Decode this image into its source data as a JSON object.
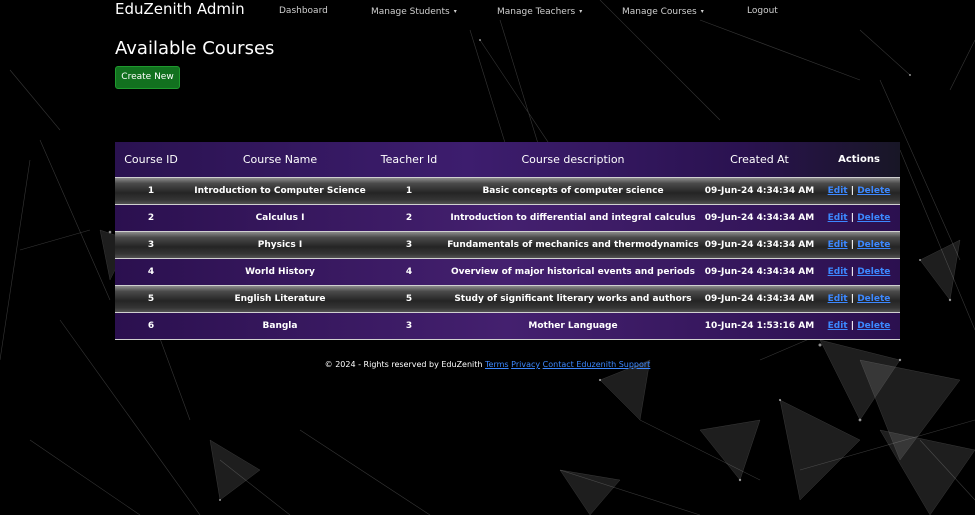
{
  "nav": {
    "brand": "EduZenith Admin",
    "items": [
      "Dashboard",
      "Manage Students",
      "Manage Teachers",
      "Manage Courses",
      "Logout"
    ],
    "caret": "▾"
  },
  "page": {
    "title": "Available Courses",
    "create_label": "Create New"
  },
  "table": {
    "headers": [
      "Course ID",
      "Course Name",
      "Teacher Id",
      "Course description",
      "Created At",
      "Actions"
    ],
    "rows": [
      {
        "id": "1",
        "name": "Introduction to Computer Science",
        "teacher": "1",
        "desc": "Basic concepts of computer science",
        "created": "09-Jun-24 4:34:34 AM"
      },
      {
        "id": "2",
        "name": "Calculus I",
        "teacher": "2",
        "desc": "Introduction to differential and integral calculus",
        "created": "09-Jun-24 4:34:34 AM"
      },
      {
        "id": "3",
        "name": "Physics I",
        "teacher": "3",
        "desc": "Fundamentals of mechanics and thermodynamics",
        "created": "09-Jun-24 4:34:34 AM"
      },
      {
        "id": "4",
        "name": "World History",
        "teacher": "4",
        "desc": "Overview of major historical events and periods",
        "created": "09-Jun-24 4:34:34 AM"
      },
      {
        "id": "5",
        "name": "English Literature",
        "teacher": "5",
        "desc": "Study of significant literary works and authors",
        "created": "09-Jun-24 4:34:34 AM"
      },
      {
        "id": "6",
        "name": "Bangla",
        "teacher": "3",
        "desc": "Mother Language",
        "created": "10-Jun-24 1:53:16 AM"
      }
    ],
    "edit_label": "Edit",
    "sep": "|",
    "delete_label": "Delete"
  },
  "footer": {
    "copyright": "© 2024 - Rights reserved by EduZenith",
    "links": [
      "Terms",
      "Privacy",
      "Contact Eduzenith Support"
    ]
  },
  "colors": {
    "accent_purple": "#3d1d6e",
    "button_green": "#12711f",
    "link_blue": "#3c88ff"
  }
}
